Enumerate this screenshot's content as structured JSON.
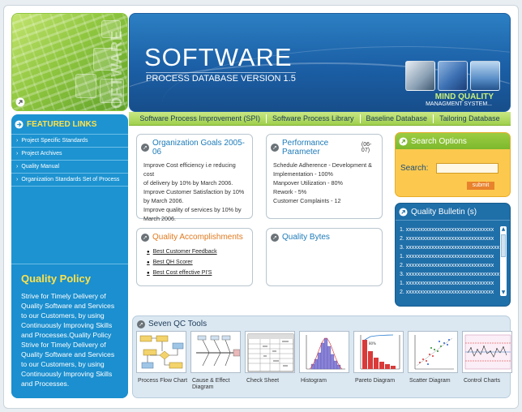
{
  "header": {
    "logo_vertical_text": "SOFTWARE",
    "title": "SOFTWARE",
    "subtitle": "PROCESS DATABASE VERSION 1.5",
    "brand_line1": "MIND QUALITY",
    "brand_line2": "MANAGMENT SYSTEM..."
  },
  "nav": {
    "items": [
      {
        "label": "Software Process Improvement (SPI)"
      },
      {
        "label": "Software Process Library"
      },
      {
        "label": "Baseline Database"
      },
      {
        "label": "Tailoring Database"
      }
    ]
  },
  "sidebar": {
    "featured_title": "FEATURED LINKS",
    "links": [
      {
        "label": "Project Specific Standards"
      },
      {
        "label": "Project Archives"
      },
      {
        "label": "Quality Manual"
      },
      {
        "label": "Organization Standards Set of Process"
      }
    ],
    "bullet": "›",
    "policy_title": "Quality Policy",
    "policy_text": "Strive for Timely Delivery of Quality Software and Services to our Customers, by using Continuously Improving Skills and Processes.Quality Policy Strive for Timely Delivery of Quality Software and Services to our Customers, by using Continuously Improving Skills and Processes."
  },
  "goals": {
    "title": "Organization Goals 2005-06",
    "lines": [
      "Improve Cost efficiency i.e reducing cost",
      "of delivery by 10% by March 2006.",
      "Improve Customer Satisfaction by 10%",
      "by March 2006.",
      "Improve quality of services by 10% by",
      "March 2006."
    ]
  },
  "performance": {
    "title": "Performance Parameter",
    "period": "(06-07)",
    "lines": [
      "Schedule Adherence - Development &",
      "Implementation - 100%",
      "Manpover Utilization - 80%",
      "Rework - 5%",
      "Customer Complaints - 12"
    ]
  },
  "accomplishments": {
    "title": "Quality Accomplishments",
    "items": [
      {
        "label": "Best Customer Feedback"
      },
      {
        "label": "Best QH Scorer"
      },
      {
        "label": "Best Cost effective PI'S"
      }
    ]
  },
  "bytes": {
    "title": "Quality Bytes"
  },
  "search": {
    "title": "Search Options",
    "label": "Search:",
    "value": "",
    "submit": "submit"
  },
  "bulletin": {
    "title": "Quality Bulletin (s)",
    "lines": [
      "1. xxxxxxxxxxxxxxxxxxxxxxxxxxxxxxx",
      "2. xxxxxxxxxxxxxxxxxxxxxxxxxxxxxxx",
      "3. xxxxxxxxxxxxxxxxxxxxxxxxxxxxxxxxx",
      "1. xxxxxxxxxxxxxxxxxxxxxxxxxxxxxxx",
      "2. xxxxxxxxxxxxxxxxxxxxxxxxxxxxxxx",
      "3. xxxxxxxxxxxxxxxxxxxxxxxxxxxxxxxxx",
      "1. xxxxxxxxxxxxxxxxxxxxxxxxxxxxxxx",
      "2. xxxxxxxxxxxxxxxxxxxxxxxxxxxxxxx"
    ]
  },
  "qc": {
    "title": "Seven QC Tools",
    "tools": [
      {
        "label": "Process Flow Chart"
      },
      {
        "label": "Cause & Effect Diagram"
      },
      {
        "label": "Check Sheet"
      },
      {
        "label": "Histogram"
      },
      {
        "label": "Pareto Diagram"
      },
      {
        "label": "Scatter Diagram"
      },
      {
        "label": "Control Charts"
      }
    ]
  },
  "colors": {
    "banner_blue": "#1b5fa6",
    "green": "#8fc63f",
    "sidebar_blue": "#1d93d1",
    "yellow_title": "#ffe24a",
    "orange": "#e07a1f",
    "search_bg": "#fcc94e"
  },
  "icons": [
    "arrow-circle-icon",
    "search-icon",
    "scroll-up-icon",
    "scroll-down-icon"
  ]
}
